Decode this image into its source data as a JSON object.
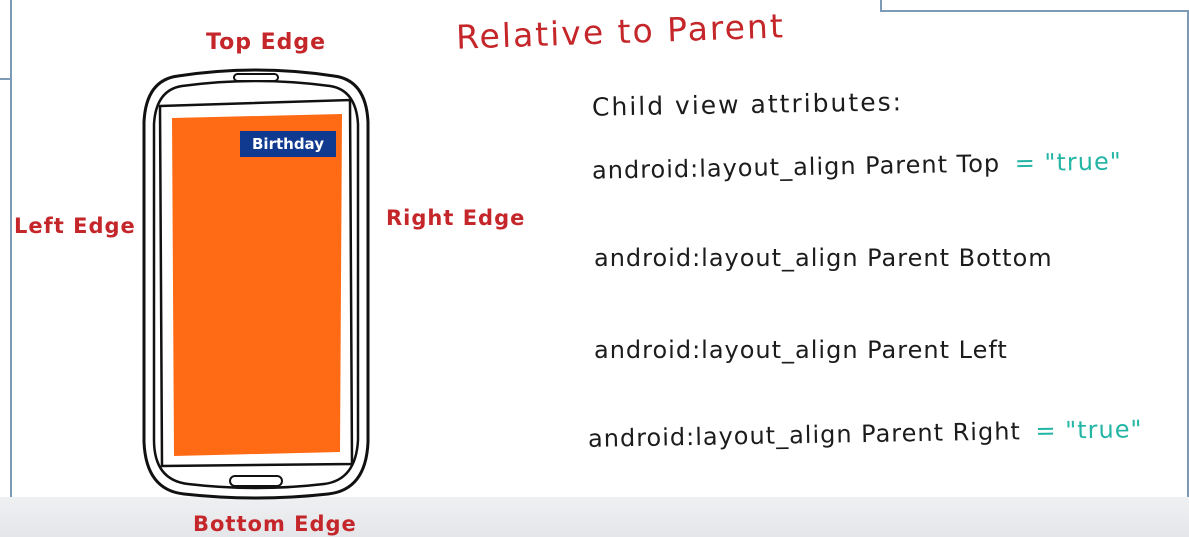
{
  "title": "Relative to Parent",
  "edges": {
    "top": "Top Edge",
    "left": "Left Edge",
    "right": "Right Edge",
    "bottom": "Bottom Edge"
  },
  "phone": {
    "child_view_label": "Birthday"
  },
  "attributes": {
    "heading": "Child view attributes:",
    "items": [
      {
        "name": "android:layout_align Parent Top",
        "value": "= \"true\""
      },
      {
        "name": "android:layout_align Parent Bottom",
        "value": ""
      },
      {
        "name": "android:layout_align Parent Left",
        "value": ""
      },
      {
        "name": "android:layout_align Parent Right",
        "value": "= \"true\""
      }
    ]
  },
  "colors": {
    "edge_label": "#c4262a",
    "attribute_text": "#1c1c1c",
    "attribute_value": "#24b5a5",
    "screen_fill": "#ff6a14",
    "child_view_fill": "#103a8f"
  }
}
